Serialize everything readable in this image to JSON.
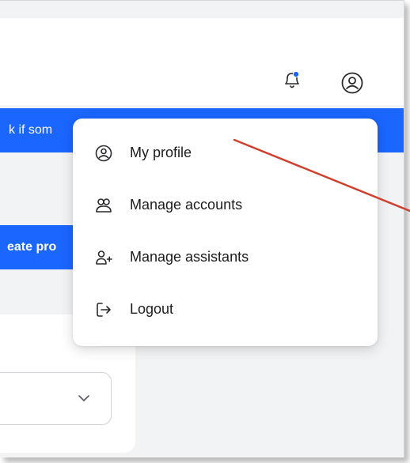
{
  "header": {
    "notifications_icon": "bell-with-dot-icon",
    "account_icon": "user-circle-icon",
    "notification_dot_color": "#1a66ff"
  },
  "banner": {
    "text": "k if som",
    "background": "#1a66ff"
  },
  "create_button": {
    "label": "eate pro"
  },
  "card": {
    "select_icon": "chevron-down-icon"
  },
  "user_menu": {
    "items": [
      {
        "label": "My profile",
        "icon": "user-circle-icon"
      },
      {
        "label": "Manage accounts",
        "icon": "users-icon"
      },
      {
        "label": "Manage assistants",
        "icon": "user-plus-icon"
      },
      {
        "label": "Logout",
        "icon": "logout-icon"
      }
    ]
  },
  "annotation": {
    "arrow_color": "#d0402e"
  }
}
